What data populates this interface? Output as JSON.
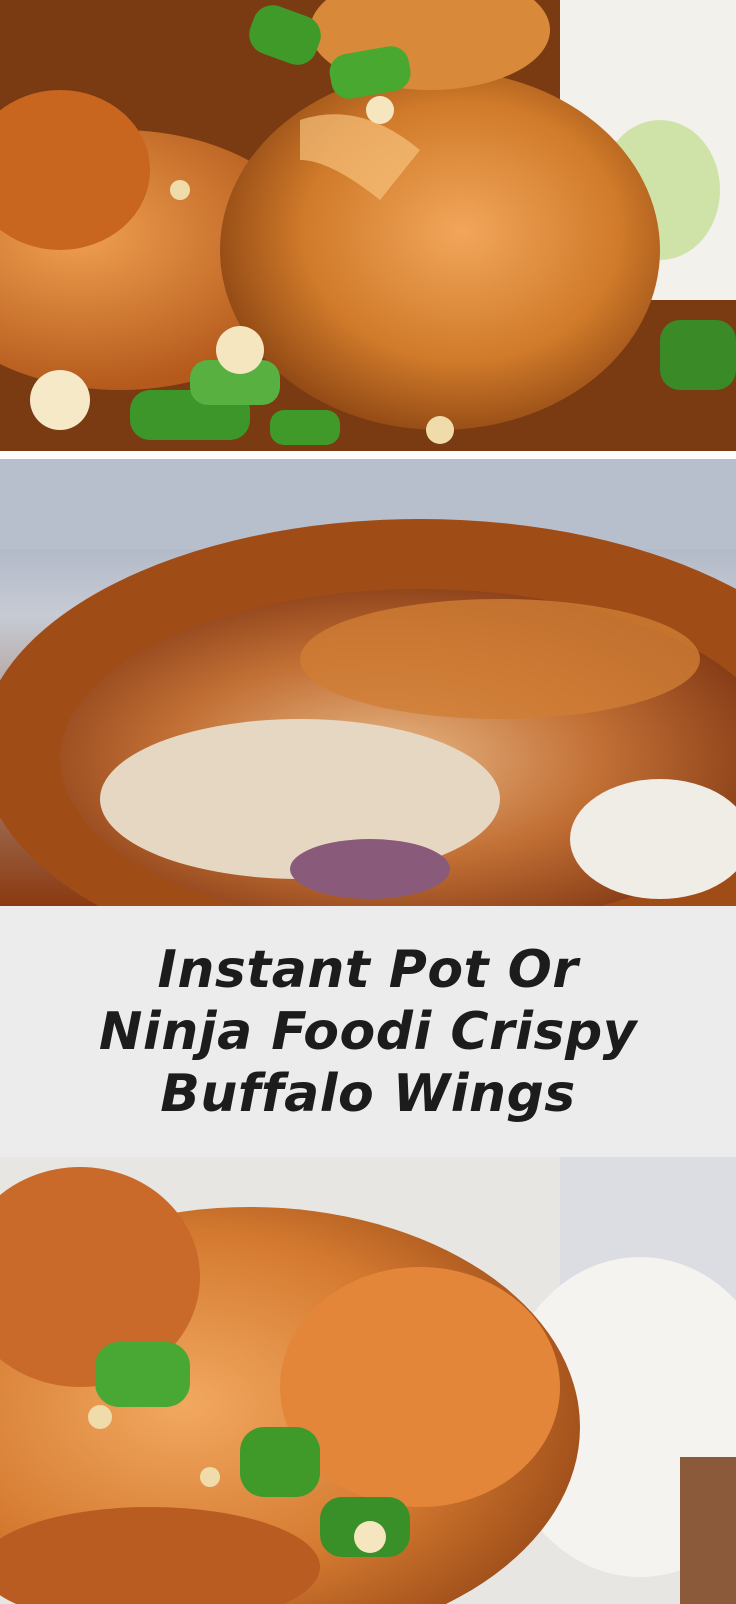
{
  "pin": {
    "title": "Instant Pot Or Ninja Foodi Crispy Buffalo Wings"
  },
  "colors": {
    "title_text": "#1c1c1c",
    "title_band": "#ececec",
    "wing_glaze": "#d9822b",
    "scallion": "#3f9a2a"
  },
  "images": [
    {
      "subject": "buffalo wings with scallions and blue cheese crumbles"
    },
    {
      "subject": "close-up of a glazed chicken wing"
    },
    {
      "subject": "buffalo wings on a white plate"
    }
  ]
}
